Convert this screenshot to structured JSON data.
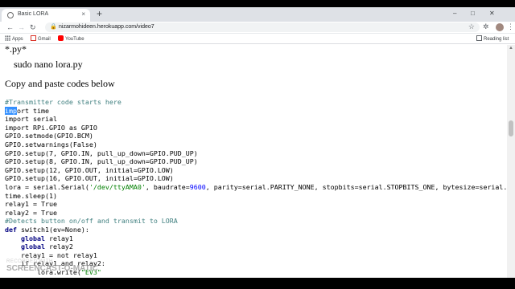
{
  "browser": {
    "tab_title": "Basic LORA",
    "tab_close": "×",
    "new_tab": "+",
    "url": "nizarmohideen.herokuapp.com/video7",
    "window_controls": [
      "–",
      "□",
      "✕"
    ],
    "nav_icons": [
      "back-icon",
      "forward-icon",
      "reload-icon"
    ],
    "bookmarks": [
      "Apps",
      "Gmail",
      "YouTube"
    ],
    "reading_list": "Reading list",
    "colors": {
      "tabstrip": "#dee1e6",
      "omnibox": "#f1f3f4",
      "selection": "#3390ff"
    }
  },
  "page": {
    "crumb": "*.py*",
    "command": "sudo nano lora.py",
    "copy_note": "Copy and paste codes below",
    "code_lines": [
      [
        [
          "#Transmitter code starts here",
          "cmt"
        ]
      ],
      [
        [
          "imp",
          "sel"
        ],
        [
          "ort time",
          ""
        ]
      ],
      [
        [
          "import serial",
          ""
        ]
      ],
      [
        [
          "import RPi.GPIO as GPIO",
          ""
        ]
      ],
      [
        [
          "GPIO.setmode(GPIO.BCM)",
          ""
        ]
      ],
      [
        [
          "GPIO.setwarnings(False)",
          ""
        ]
      ],
      [
        [
          "GPIO.setup(7, GPIO.IN, pull_up_down=GPIO.PUD_UP)",
          ""
        ]
      ],
      [
        [
          "GPIO.setup(8, GPIO.IN, pull_up_down=GPIO.PUD_UP)",
          ""
        ]
      ],
      [
        [
          "GPIO.setup(12, GPIO.OUT, initial=GPIO.LOW)",
          ""
        ]
      ],
      [
        [
          "GPIO.setup(16, GPIO.OUT, initial=GPIO.LOW)",
          ""
        ]
      ],
      [
        [
          "lora = serial.Serial(",
          ""
        ],
        [
          "'/dev/ttyAMA0'",
          "str"
        ],
        [
          ", baudrate=",
          ""
        ],
        [
          "9600",
          "num"
        ],
        [
          ", parity=serial.PARITY_NONE, stopbits=serial.STOPBITS_ONE, bytesize=serial.",
          ""
        ]
      ],
      [
        [
          "time.sleep(1)",
          ""
        ]
      ],
      [
        [
          "relay1 = True",
          ""
        ]
      ],
      [
        [
          "relay2 = True",
          ""
        ]
      ],
      [
        [
          "#Detects button on/off and transmit to LORA",
          "cmt"
        ]
      ],
      [
        [
          "def ",
          "kw"
        ],
        [
          "switch1(ev=None):",
          ""
        ]
      ],
      [
        [
          "    global ",
          "kw"
        ],
        [
          "relay1",
          ""
        ]
      ],
      [
        [
          "    global ",
          "kw"
        ],
        [
          "relay2",
          ""
        ]
      ],
      [
        [
          "    relay1 = not relay1",
          ""
        ]
      ],
      [
        [
          "    if relay1 and relay2:",
          ""
        ]
      ],
      [
        [
          "        lora.write(",
          ""
        ],
        [
          "\"EV3\"",
          "str"
        ]
      ]
    ]
  },
  "watermark": {
    "line1": "RECORDED WITH",
    "line2": "SCREENCAST-O-MATIC"
  }
}
